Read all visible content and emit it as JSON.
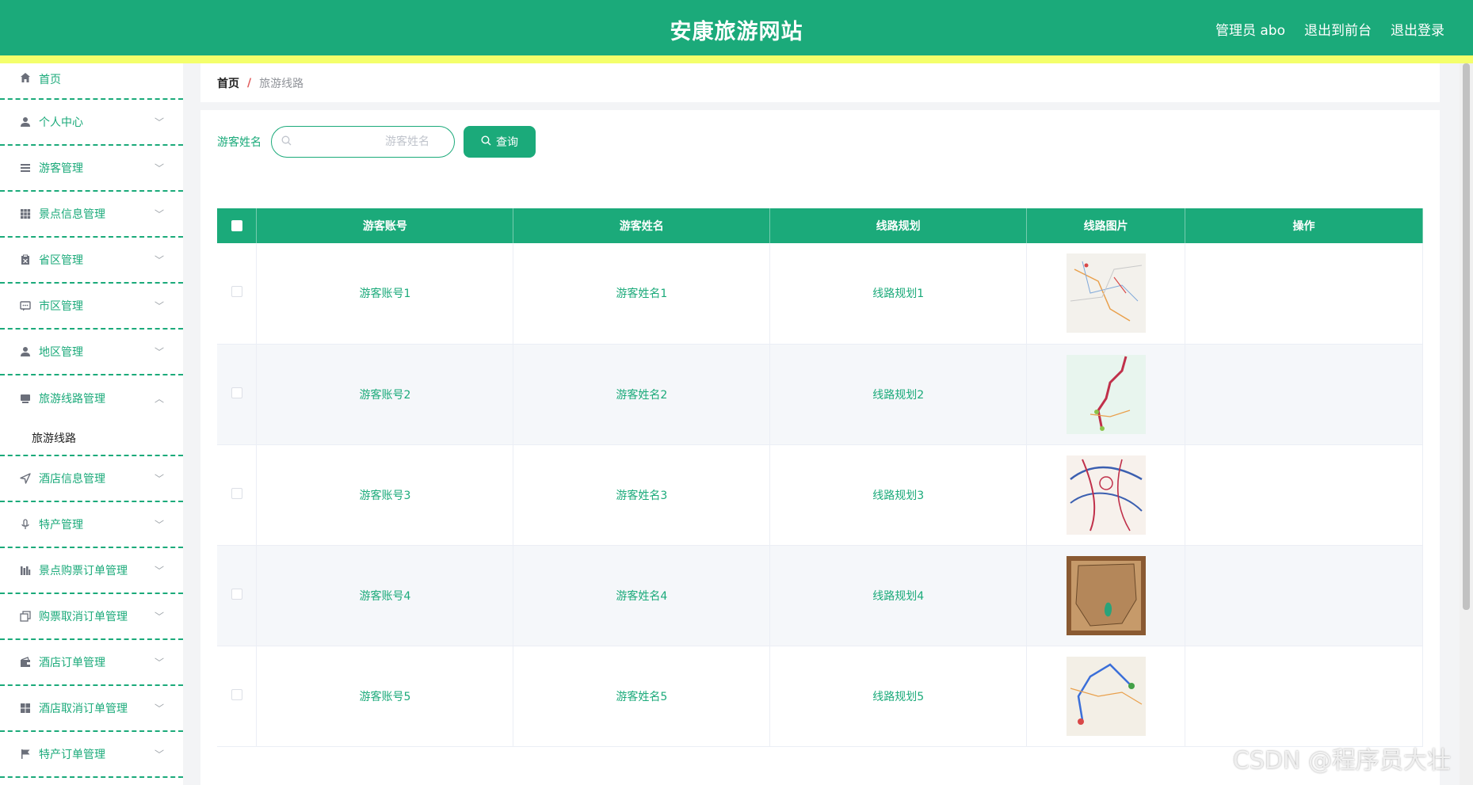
{
  "header": {
    "title": "安康旅游网站",
    "admin_label": "管理员 abo",
    "front_link": "退出到前台",
    "logout_link": "退出登录",
    "accent_color": "#1baa7a"
  },
  "sidebar": {
    "items": [
      {
        "label": "首页",
        "icon": "home-icon"
      },
      {
        "label": "个人中心",
        "icon": "user-icon"
      },
      {
        "label": "游客管理",
        "icon": "list-icon"
      },
      {
        "label": "景点信息管理",
        "icon": "grid-icon"
      },
      {
        "label": "省区管理",
        "icon": "clipboard-icon"
      },
      {
        "label": "市区管理",
        "icon": "chat-icon"
      },
      {
        "label": "地区管理",
        "icon": "user-icon"
      },
      {
        "label": "旅游线路管理",
        "icon": "monitor-icon"
      },
      {
        "label": "酒店信息管理",
        "icon": "navigation-icon"
      },
      {
        "label": "特产管理",
        "icon": "microphone-icon"
      },
      {
        "label": "景点购票订单管理",
        "icon": "chart-icon"
      },
      {
        "label": "购票取消订单管理",
        "icon": "copy-icon"
      },
      {
        "label": "酒店订单管理",
        "icon": "wallet-icon"
      },
      {
        "label": "酒店取消订单管理",
        "icon": "apps-icon"
      },
      {
        "label": "特产订单管理",
        "icon": "flag-icon"
      }
    ],
    "submenu": {
      "label": "旅游线路"
    }
  },
  "breadcrumb": {
    "home": "首页",
    "separator": "/",
    "current": "旅游线路"
  },
  "search": {
    "label": "游客姓名",
    "placeholder": "游客姓名",
    "button": "查询"
  },
  "table": {
    "headers": [
      "游客账号",
      "游客姓名",
      "线路规划",
      "线路图片",
      "操作"
    ],
    "rows": [
      {
        "account": "游客账号1",
        "name": "游客姓名1",
        "route": "线路规划1"
      },
      {
        "account": "游客账号2",
        "name": "游客姓名2",
        "route": "线路规划2"
      },
      {
        "account": "游客账号3",
        "name": "游客姓名3",
        "route": "线路规划3"
      },
      {
        "account": "游客账号4",
        "name": "游客姓名4",
        "route": "线路规划4"
      },
      {
        "account": "游客账号5",
        "name": "游客姓名5",
        "route": "线路规划5"
      }
    ]
  },
  "watermark": "CSDN @程序员大壮"
}
